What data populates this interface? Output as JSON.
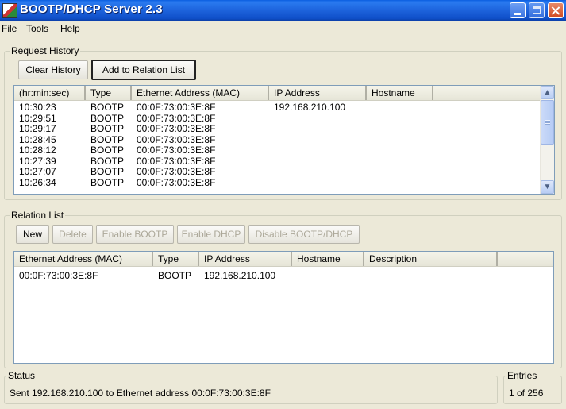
{
  "window": {
    "title": "BOOTP/DHCP Server 2.3",
    "icon": "app-icon",
    "controls": [
      "minimize",
      "maximize",
      "close"
    ]
  },
  "menu": {
    "items": [
      "File",
      "Tools",
      "Help"
    ]
  },
  "request_history": {
    "label": "Request History",
    "buttons": {
      "clear": "Clear History",
      "add": "Add to Relation List"
    },
    "columns": [
      "(hr:min:sec)",
      "Type",
      "Ethernet Address (MAC)",
      "IP Address",
      "Hostname"
    ],
    "rows": [
      {
        "time": "10:30:23",
        "type": "BOOTP",
        "mac": "00:0F:73:00:3E:8F",
        "ip": "192.168.210.100",
        "hostname": ""
      },
      {
        "time": "10:29:51",
        "type": "BOOTP",
        "mac": "00:0F:73:00:3E:8F",
        "ip": "",
        "hostname": ""
      },
      {
        "time": "10:29:17",
        "type": "BOOTP",
        "mac": "00:0F:73:00:3E:8F",
        "ip": "",
        "hostname": ""
      },
      {
        "time": "10:28:45",
        "type": "BOOTP",
        "mac": "00:0F:73:00:3E:8F",
        "ip": "",
        "hostname": ""
      },
      {
        "time": "10:28:12",
        "type": "BOOTP",
        "mac": "00:0F:73:00:3E:8F",
        "ip": "",
        "hostname": ""
      },
      {
        "time": "10:27:39",
        "type": "BOOTP",
        "mac": "00:0F:73:00:3E:8F",
        "ip": "",
        "hostname": ""
      },
      {
        "time": "10:27:07",
        "type": "BOOTP",
        "mac": "00:0F:73:00:3E:8F",
        "ip": "",
        "hostname": ""
      },
      {
        "time": "10:26:34",
        "type": "BOOTP",
        "mac": "00:0F:73:00:3E:8F",
        "ip": "",
        "hostname": ""
      }
    ],
    "scroll_up": "up-arrow-icon",
    "scroll_down": "down-arrow-icon"
  },
  "relation_list": {
    "label": "Relation List",
    "buttons": {
      "new": "New",
      "delete": "Delete",
      "enable_bootp": "Enable BOOTP",
      "enable_dhcp": "Enable DHCP",
      "disable": "Disable BOOTP/DHCP"
    },
    "columns": [
      "Ethernet Address (MAC)",
      "Type",
      "IP Address",
      "Hostname",
      "Description"
    ],
    "rows": [
      {
        "mac": "00:0F:73:00:3E:8F",
        "type": "BOOTP",
        "ip": "192.168.210.100",
        "hostname": "",
        "description": ""
      }
    ]
  },
  "status": {
    "label": "Status",
    "text": "Sent 192.168.210.100 to Ethernet address 00:0F:73:00:3E:8F"
  },
  "entries": {
    "label": "Entries",
    "text": "1 of 256"
  }
}
